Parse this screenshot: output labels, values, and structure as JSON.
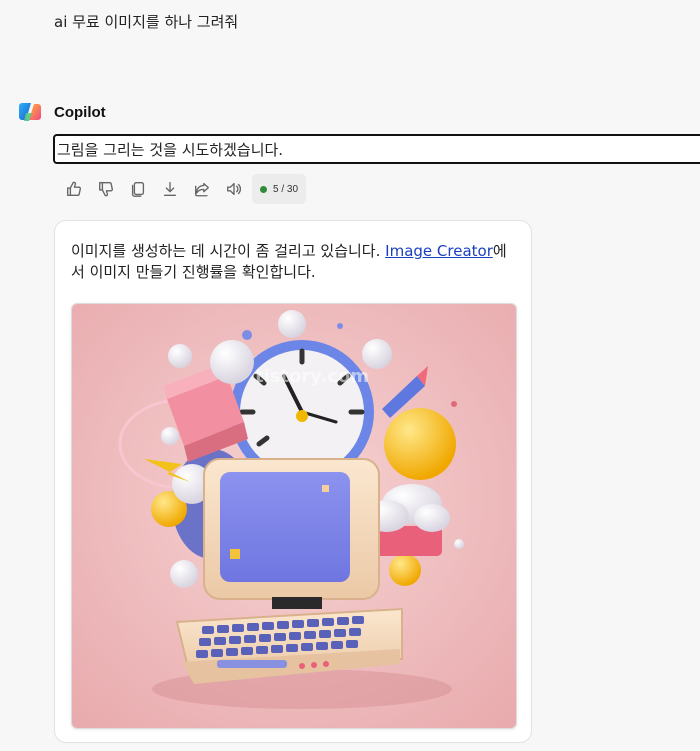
{
  "user": {
    "message": "ai 무료 이미지를 하나 그려줘"
  },
  "copilot": {
    "name": "Copilot"
  },
  "reply": {
    "text": "그림을 그리는 것을 시도하겠습니다."
  },
  "actions": {
    "icons": [
      "thumbs-up-icon",
      "thumbs-down-icon",
      "copy-icon",
      "download-icon",
      "share-icon",
      "speaker-icon"
    ],
    "counter": "5 / 30",
    "counter_color": "#2f8a3a"
  },
  "card": {
    "text_before": "이미지를 생성하는 데 시간이 좀 걸리고 있습니다. ",
    "link": "Image Creator",
    "text_after": "에서 이미지 만들기 진행률을 확인합니다.",
    "link_color": "#1a3fc0"
  },
  "image": {
    "description_icon": "generated-image",
    "watermark": "tistory.com"
  }
}
